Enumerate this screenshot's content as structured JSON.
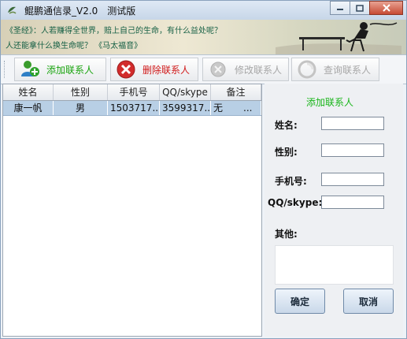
{
  "window": {
    "title": "鲲鹏通信录_V2.0",
    "subtitle": "测试版"
  },
  "banner": {
    "line1": "《圣经》：人若赚得全世界，赔上自己的生命，有什么益处呢？",
    "line2": "人还能拿什么换生命呢？  《马太福音》"
  },
  "toolbar": {
    "add_label": "添加联系人",
    "delete_label": "删除联系人",
    "edit_label": "修改联系人",
    "query_label": "查询联系人"
  },
  "table": {
    "headers": [
      "姓名",
      "性别",
      "手机号",
      "QQ/skype",
      "备注"
    ],
    "rows": [
      [
        "康一帆",
        "男",
        "1503717...",
        "3599317...",
        "无"
      ]
    ],
    "cell_trailing_ellipsis": "..."
  },
  "form": {
    "title": "添加联系人",
    "name_label": "姓名:",
    "gender_label": "性别:",
    "phone_label": "手机号:",
    "qq_label": "QQ/skype:",
    "other_label": "其他:",
    "name_value": "",
    "gender_value": "",
    "phone_value": "",
    "qq_value": "",
    "other_value": "",
    "ok_label": "确定",
    "cancel_label": "取消"
  },
  "colors": {
    "add_text": "#18a30d",
    "delete_text": "#d01818",
    "disabled_text": "#a6a6a6",
    "form_title": "#18b519",
    "selected_row": "#b8cfe5"
  },
  "icons": [
    "app-icon",
    "minimize-icon",
    "maximize-icon",
    "close-icon",
    "add-user-icon",
    "delete-icon",
    "edit-icon",
    "search-icon"
  ]
}
